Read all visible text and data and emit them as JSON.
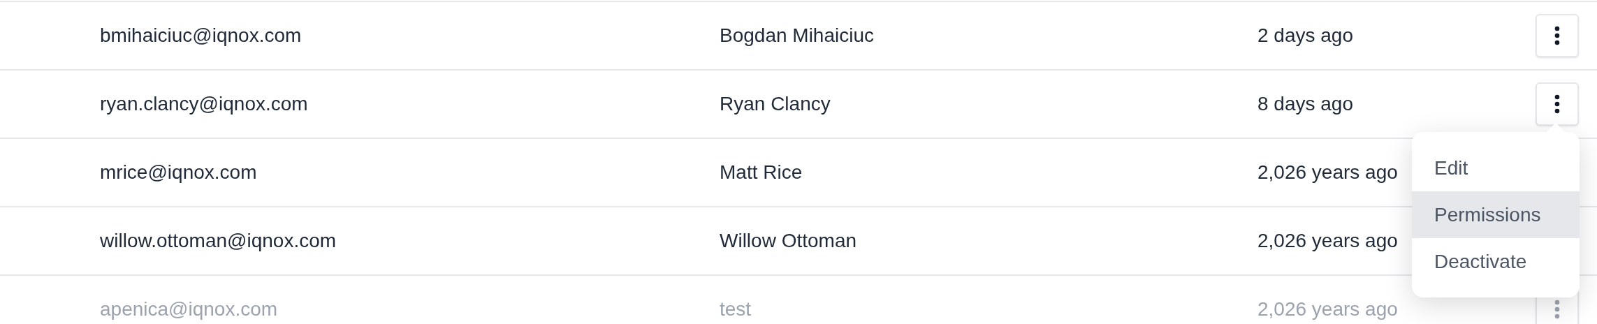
{
  "rows": [
    {
      "email": "bmihaiciuc@iqnox.com",
      "name": "Bogdan Mihaiciuc",
      "last_seen": "2 days ago",
      "disabled": false,
      "menu_open": false
    },
    {
      "email": "ryan.clancy@iqnox.com",
      "name": "Ryan Clancy",
      "last_seen": "8 days ago",
      "disabled": false,
      "menu_open": true
    },
    {
      "email": "mrice@iqnox.com",
      "name": "Matt Rice",
      "last_seen": "2,026 years ago",
      "disabled": false,
      "menu_open": false
    },
    {
      "email": "willow.ottoman@iqnox.com",
      "name": "Willow Ottoman",
      "last_seen": "2,026 years ago",
      "disabled": false,
      "menu_open": false
    },
    {
      "email": "apenica@iqnox.com",
      "name": "test",
      "last_seen": "2,026 years ago",
      "disabled": true,
      "menu_open": false
    }
  ],
  "row_menu": {
    "items": [
      {
        "label": "Edit",
        "selected": false
      },
      {
        "label": "Permissions",
        "selected": true
      },
      {
        "label": "Deactivate",
        "selected": false
      }
    ]
  }
}
